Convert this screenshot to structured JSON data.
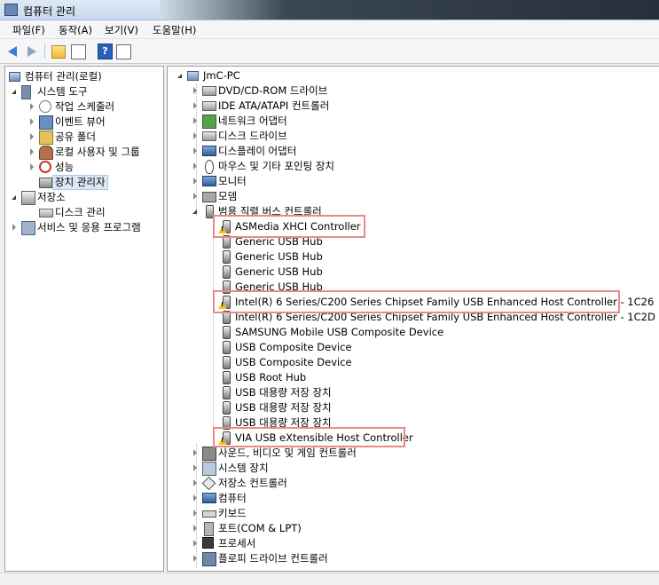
{
  "window": {
    "title": "컴퓨터 관리"
  },
  "menu": [
    {
      "label": "파일(F)"
    },
    {
      "label": "동작(A)"
    },
    {
      "label": "보기(V)"
    },
    {
      "label": "도움말(H)"
    }
  ],
  "toolbar": {
    "help_glyph": "?"
  },
  "left_tree": {
    "root": "컴퓨터 관리(로컬)",
    "system_tools": "시스템 도구",
    "task_scheduler": "작업 스케줄러",
    "event_viewer": "이벤트 뷰어",
    "shared_folders": "공유 폴더",
    "local_users": "로컬 사용자 및 그룹",
    "performance": "성능",
    "device_manager": "장치 관리자",
    "storage": "저장소",
    "disk_management": "디스크 관리",
    "services_apps": "서비스 및 응용 프로그램"
  },
  "right_tree": {
    "root": "JmC-PC",
    "categories_before": [
      {
        "label": "DVD/CD-ROM 드라이브",
        "icon": "drive-icon"
      },
      {
        "label": "IDE ATA/ATAPI 컨트롤러",
        "icon": "ide-controller-icon"
      },
      {
        "label": "네트워크 어댑터",
        "icon": "network-icon"
      },
      {
        "label": "디스크 드라이브",
        "icon": "disk-drive-icon"
      },
      {
        "label": "디스플레이 어댑터",
        "icon": "display-adapter-icon"
      },
      {
        "label": "마우스 및 기타 포인팅 장치",
        "icon": "mouse-icon"
      },
      {
        "label": "모니터",
        "icon": "monitor-icon"
      },
      {
        "label": "모뎀",
        "icon": "modem-icon"
      }
    ],
    "usb_category": "범용 직렬 버스 컨트롤러",
    "usb_devices": [
      {
        "label": "ASMedia XHCI Controller",
        "warning": true
      },
      {
        "label": "Generic USB Hub",
        "warning": false
      },
      {
        "label": "Generic USB Hub",
        "warning": false
      },
      {
        "label": "Generic USB Hub",
        "warning": false
      },
      {
        "label": "Generic USB Hub",
        "warning": false
      },
      {
        "label": "Intel(R) 6 Series/C200 Series Chipset Family USB Enhanced Host Controller - 1C26",
        "warning": true
      },
      {
        "label": "Intel(R) 6 Series/C200 Series Chipset Family USB Enhanced Host Controller - 1C2D",
        "warning": false
      },
      {
        "label": "SAMSUNG Mobile USB Composite Device",
        "warning": false
      },
      {
        "label": "USB Composite Device",
        "warning": false
      },
      {
        "label": "USB Composite Device",
        "warning": false
      },
      {
        "label": "USB Root Hub",
        "warning": false
      },
      {
        "label": "USB 대용량 저장 장치",
        "warning": false
      },
      {
        "label": "USB 대용량 저장 장치",
        "warning": false
      },
      {
        "label": "USB 대용량 저장 장치",
        "warning": false
      },
      {
        "label": "VIA USB eXtensible Host Controller",
        "warning": true
      }
    ],
    "categories_after": [
      {
        "label": "사운드, 비디오 및 게임 컨트롤러",
        "icon": "sound-icon"
      },
      {
        "label": "시스템 장치",
        "icon": "system-device-icon"
      },
      {
        "label": "저장소 컨트롤러",
        "icon": "storage-controller-icon"
      },
      {
        "label": "컴퓨터",
        "icon": "computer-icon"
      },
      {
        "label": "키보드",
        "icon": "keyboard-icon"
      },
      {
        "label": "포트(COM & LPT)",
        "icon": "port-icon"
      },
      {
        "label": "프로세서",
        "icon": "processor-icon"
      },
      {
        "label": "플로피 드라이브 컨트롤러",
        "icon": "floppy-controller-icon"
      }
    ]
  },
  "colors": {
    "highlight_box": "#e88a8a",
    "warning": "#f3c21a"
  }
}
